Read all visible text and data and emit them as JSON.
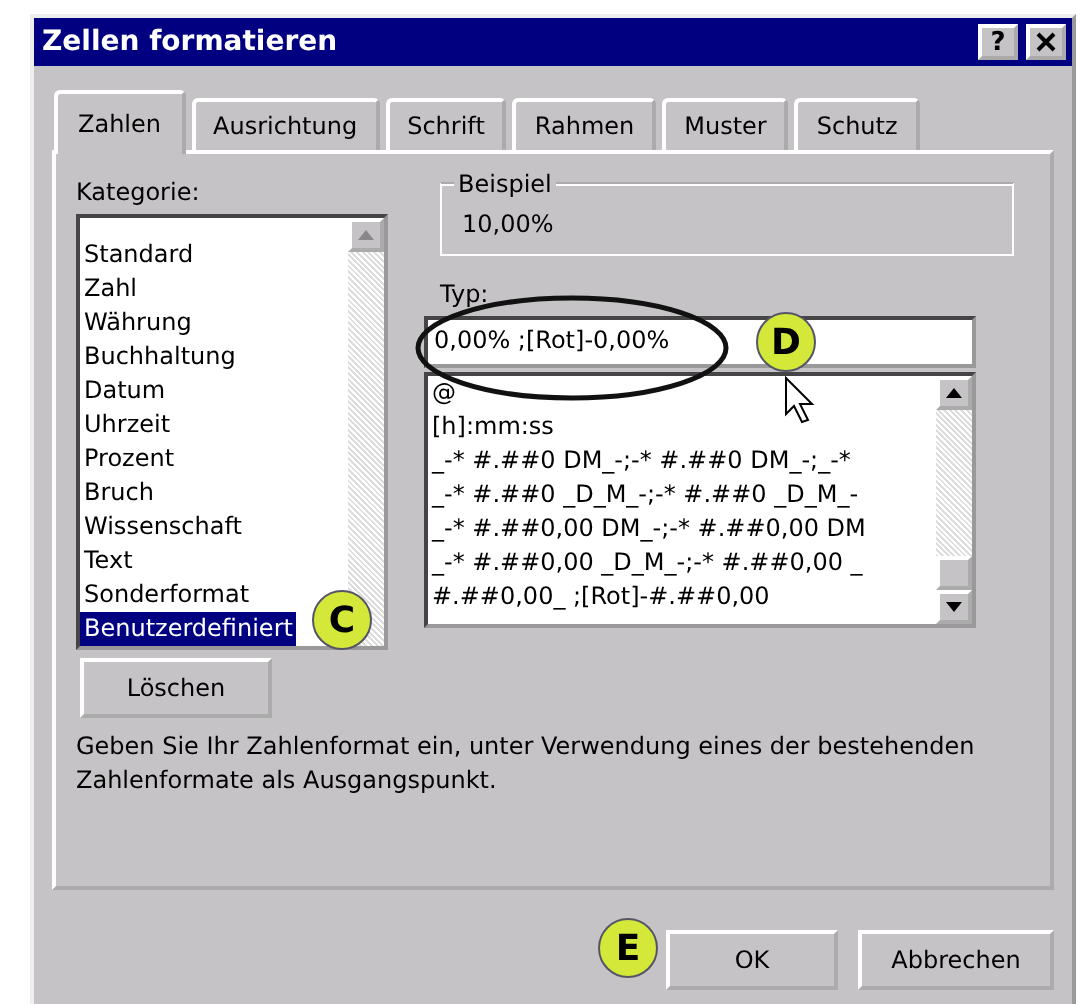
{
  "window": {
    "title": "Zellen formatieren",
    "help_button": "?"
  },
  "tabs": [
    {
      "label": "Zahlen",
      "selected": true
    },
    {
      "label": "Ausrichtung",
      "selected": false
    },
    {
      "label": "Schrift",
      "selected": false
    },
    {
      "label": "Rahmen",
      "selected": false
    },
    {
      "label": "Muster",
      "selected": false
    },
    {
      "label": "Schutz",
      "selected": false
    }
  ],
  "category": {
    "label": "Kategorie:",
    "items": [
      {
        "label": "Standard",
        "selected": false
      },
      {
        "label": "Zahl",
        "selected": false
      },
      {
        "label": "Währung",
        "selected": false
      },
      {
        "label": "Buchhaltung",
        "selected": false
      },
      {
        "label": "Datum",
        "selected": false
      },
      {
        "label": "Uhrzeit",
        "selected": false
      },
      {
        "label": "Prozent",
        "selected": false
      },
      {
        "label": "Bruch",
        "selected": false
      },
      {
        "label": "Wissenschaft",
        "selected": false
      },
      {
        "label": "Text",
        "selected": false
      },
      {
        "label": "Sonderformat",
        "selected": false
      },
      {
        "label": "Benutzerdefiniert",
        "selected": true
      }
    ]
  },
  "sample": {
    "label": "Beispiel",
    "value": "10,00%"
  },
  "type": {
    "label": "Typ:",
    "value": "0,00% ;[Rot]-0,00%",
    "formats": [
      "@",
      "[h]:mm:ss",
      "_-* #.##0 DM_-;-* #.##0 DM_-;_-*",
      "_-* #.##0 _D_M_-;-* #.##0 _D_M_-",
      "_-* #.##0,00 DM_-;-* #.##0,00 DM",
      "_-* #.##0,00 _D_M_-;-* #.##0,00 _",
      "#.##0,00_ ;[Rot]-#.##0,00"
    ]
  },
  "delete_button": "Löschen",
  "description": "Geben Sie Ihr Zahlenformat ein, unter Verwendung eines der bestehenden Zahlenformate als Ausgangspunkt.",
  "buttons": [
    "OK",
    "Abbrechen"
  ],
  "callouts": [
    "C",
    "D",
    "E"
  ]
}
